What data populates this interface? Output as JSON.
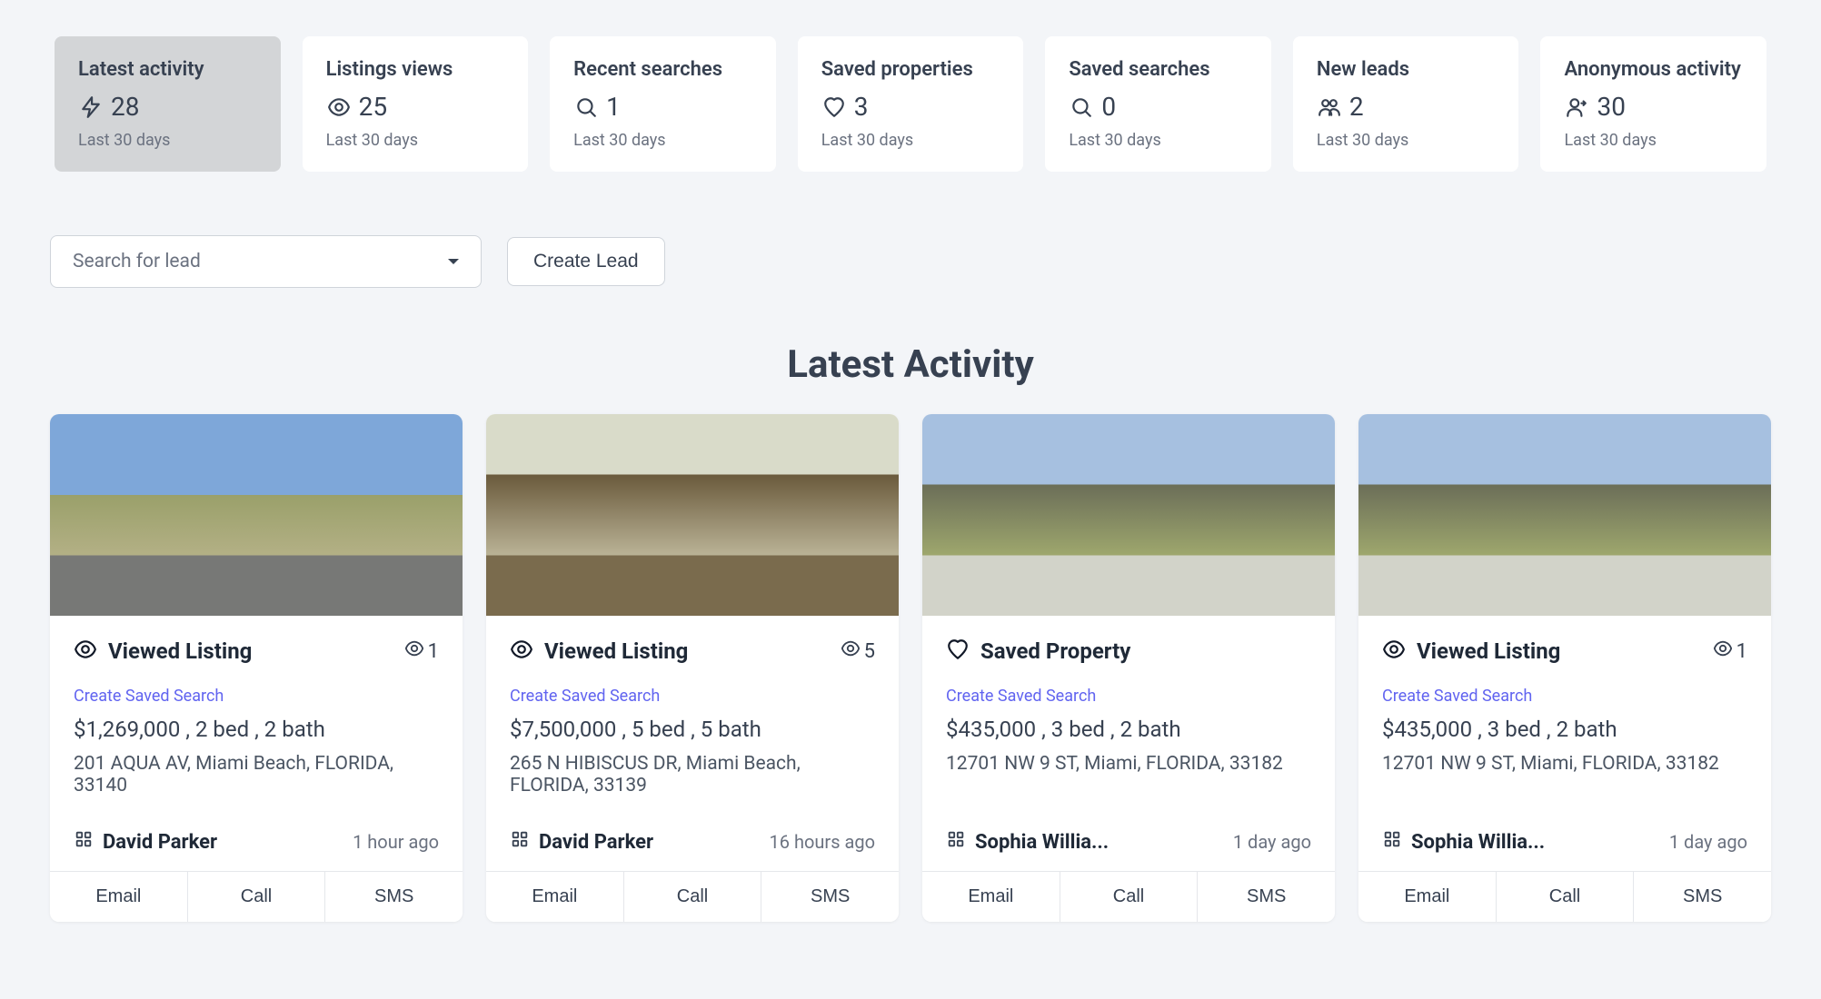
{
  "stats": [
    {
      "title": "Latest activity",
      "value": "28",
      "sub": "Last 30 days",
      "icon": "bolt",
      "active": true
    },
    {
      "title": "Listings views",
      "value": "25",
      "sub": "Last 30 days",
      "icon": "eye",
      "active": false
    },
    {
      "title": "Recent searches",
      "value": "1",
      "sub": "Last 30 days",
      "icon": "search",
      "active": false
    },
    {
      "title": "Saved properties",
      "value": "3",
      "sub": "Last 30 days",
      "icon": "heart",
      "active": false
    },
    {
      "title": "Saved searches",
      "value": "0",
      "sub": "Last 30 days",
      "icon": "search",
      "active": false
    },
    {
      "title": "New leads",
      "value": "2",
      "sub": "Last 30 days",
      "icon": "people",
      "active": false
    },
    {
      "title": "Anonymous activity",
      "value": "30",
      "sub": "Last 30 days",
      "icon": "anon",
      "active": false
    }
  ],
  "controls": {
    "search_placeholder": "Search for lead",
    "create_lead_label": "Create Lead"
  },
  "section_heading": "Latest Activity",
  "activities": [
    {
      "type_icon": "eye",
      "type_label": "Viewed Listing",
      "views": "1",
      "show_views": true,
      "create_link": "Create Saved Search",
      "price_line": "$1,269,000 , 2 bed , 2 bath",
      "address": "201 AQUA AV, Miami Beach, FLORIDA, 33140",
      "agent": "David Parker",
      "timeago": "1 hour ago",
      "actions": [
        "Email",
        "Call",
        "SMS"
      ],
      "img_class": "house-bg-1"
    },
    {
      "type_icon": "eye",
      "type_label": "Viewed Listing",
      "views": "5",
      "show_views": true,
      "create_link": "Create Saved Search",
      "price_line": "$7,500,000 , 5 bed , 5 bath",
      "address": "265 N HIBISCUS DR, Miami Beach, FLORIDA, 33139",
      "agent": "David Parker",
      "timeago": "16 hours ago",
      "actions": [
        "Email",
        "Call",
        "SMS"
      ],
      "img_class": "house-bg-2"
    },
    {
      "type_icon": "heart",
      "type_label": "Saved Property",
      "views": "",
      "show_views": false,
      "create_link": "Create Saved Search",
      "price_line": "$435,000 , 3 bed , 2 bath",
      "address": "12701 NW 9 ST, Miami, FLORIDA, 33182",
      "agent": "Sophia Willia...",
      "timeago": "1 day ago",
      "actions": [
        "Email",
        "Call",
        "SMS"
      ],
      "img_class": "house-bg-3"
    },
    {
      "type_icon": "eye",
      "type_label": "Viewed Listing",
      "views": "1",
      "show_views": true,
      "create_link": "Create Saved Search",
      "price_line": "$435,000 , 3 bed , 2 bath",
      "address": "12701 NW 9 ST, Miami, FLORIDA, 33182",
      "agent": "Sophia Willia...",
      "timeago": "1 day ago",
      "actions": [
        "Email",
        "Call",
        "SMS"
      ],
      "img_class": "house-bg-3"
    }
  ]
}
